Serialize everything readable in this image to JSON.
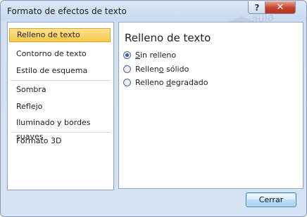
{
  "window": {
    "title": "Formato de efectos de texto",
    "help_glyph": "?",
    "close_glyph": "✕"
  },
  "watermark": {
    "line1": "aula",
    "line2": "clic"
  },
  "sidebar": {
    "items": [
      {
        "label": "Relleno de texto",
        "selected": true
      },
      {
        "label": "Contorno de texto",
        "selected": false
      },
      {
        "label": "Estilo de esquema",
        "selected": false
      },
      {
        "label": "Sombra",
        "selected": false
      },
      {
        "label": "Reflejo",
        "selected": false
      },
      {
        "label": "Iluminado y bordes suaves",
        "selected": false
      },
      {
        "label": "Formato 3D",
        "selected": false
      }
    ]
  },
  "panel": {
    "title": "Relleno de texto",
    "options": [
      {
        "label": "Sin relleno",
        "mnemonic": "S",
        "rest": "in relleno",
        "selected": true
      },
      {
        "label": "Relleno sólido",
        "mnemonic": "o",
        "before": "Rellen",
        "rest": " sólido",
        "selected": false
      },
      {
        "label": "Relleno degradado",
        "mnemonic": "d",
        "before": "Relleno ",
        "rest": "egradado",
        "selected": false
      }
    ]
  },
  "footer": {
    "close_label": "Cerrar"
  },
  "colors": {
    "selection_fill": "#f9c94a",
    "selection_border": "#e3a527",
    "close_button": "#c3432d"
  }
}
